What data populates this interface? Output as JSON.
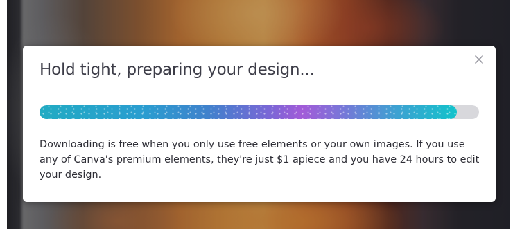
{
  "dialog": {
    "title": "Hold tight, preparing your design...",
    "close_label": "×",
    "progress_percent": 95,
    "description": "Downloading is free when you only use free elements or your own images. If you use any of Canva's premium elements, they're just $1 apiece and you have 24 hours to edit your design."
  },
  "icons": {
    "close": "close-icon"
  },
  "colors": {
    "progress_start": "#21abc3",
    "progress_mid": "#a25bd8",
    "progress_end": "#12c3cb",
    "track": "#d8d8dc",
    "title_text": "#3d3d48"
  }
}
